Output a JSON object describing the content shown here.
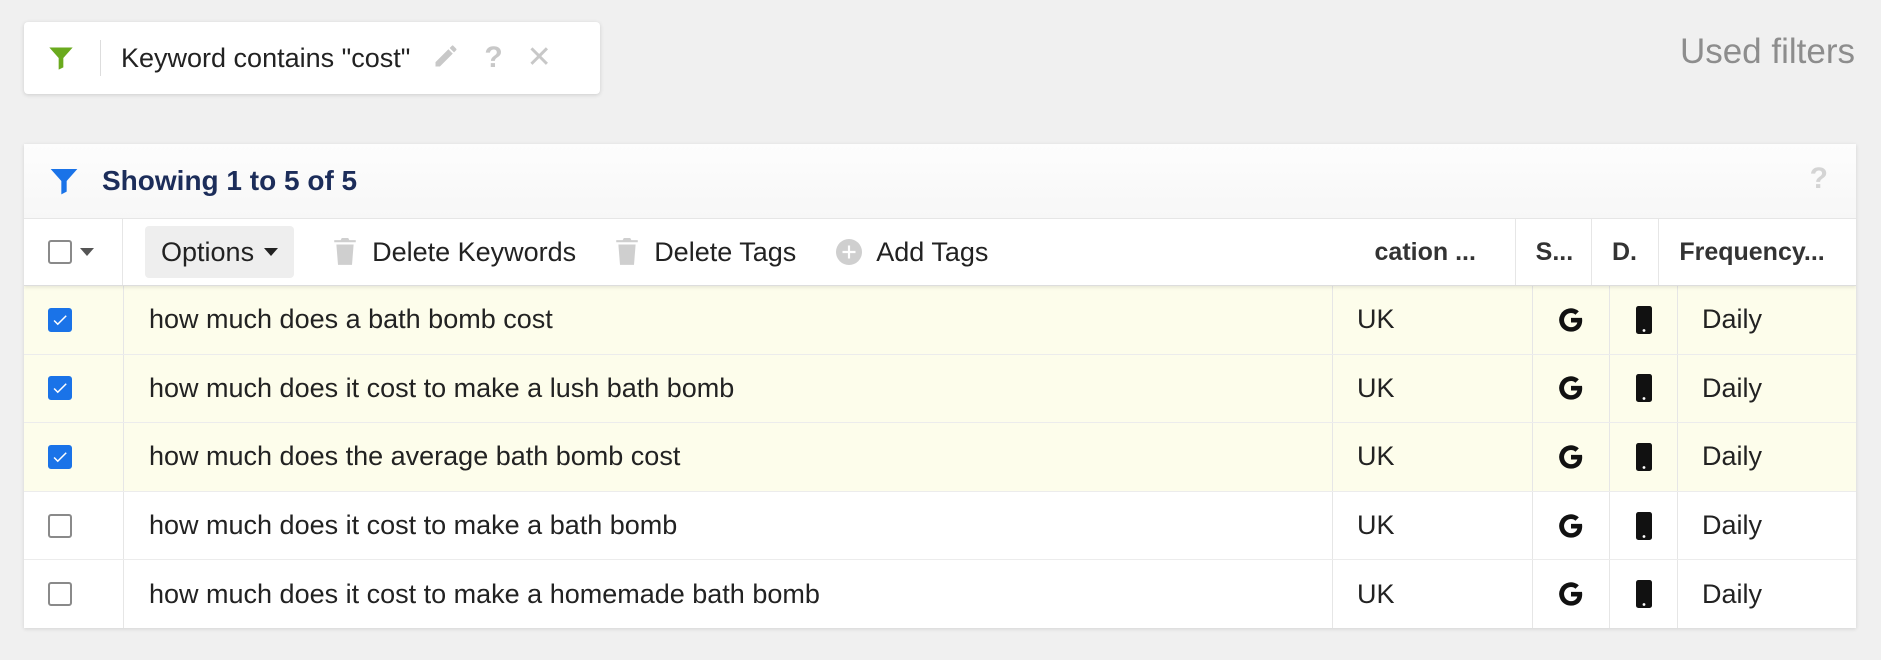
{
  "filter": {
    "text": "Keyword contains \"cost\"",
    "icons": [
      "pencil-icon",
      "question-icon",
      "close-icon"
    ],
    "accent": "#6aaa1e"
  },
  "used_filters_label": "Used filters",
  "panel": {
    "title": "Showing 1 to 5 of 5",
    "help": "?",
    "accent": "#1a73e8"
  },
  "toolbar": {
    "options_label": "Options",
    "delete_keywords_label": "Delete Keywords",
    "delete_tags_label": "Delete Tags",
    "add_tags_label": "Add Tags"
  },
  "columns": {
    "location": "cation ...",
    "search_engine": "S...",
    "device": "D.",
    "frequency": "Frequency..."
  },
  "rows": [
    {
      "keyword": "how much does a bath bomb cost",
      "location": "UK",
      "engine": "google-icon",
      "device": "mobile-icon",
      "frequency": "Daily",
      "checked": true
    },
    {
      "keyword": "how much does it cost to make a lush bath bomb",
      "location": "UK",
      "engine": "google-icon",
      "device": "mobile-icon",
      "frequency": "Daily",
      "checked": true
    },
    {
      "keyword": "how much does the average bath bomb cost",
      "location": "UK",
      "engine": "google-icon",
      "device": "mobile-icon",
      "frequency": "Daily",
      "checked": true
    },
    {
      "keyword": "how much does it cost to make a bath bomb",
      "location": "UK",
      "engine": "google-icon",
      "device": "mobile-icon",
      "frequency": "Daily",
      "checked": false
    },
    {
      "keyword": "how much does it cost to make a homemade bath bomb",
      "location": "UK",
      "engine": "google-icon",
      "device": "mobile-icon",
      "frequency": "Daily",
      "checked": false
    }
  ]
}
